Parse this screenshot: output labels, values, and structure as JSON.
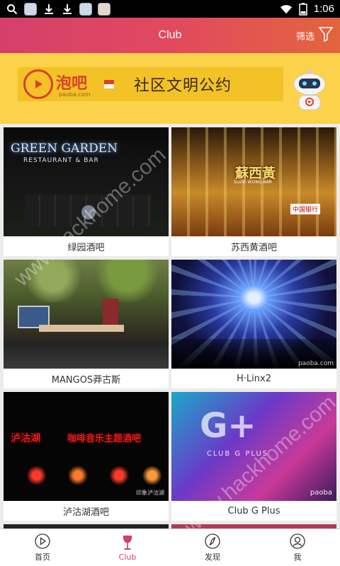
{
  "status_bar": {
    "time": "1:06",
    "battery": "8"
  },
  "header": {
    "title": "Club",
    "filter_label": "筛选"
  },
  "banner": {
    "logo_text": "泡吧",
    "logo_sub": "paoba.com",
    "slogan": "社区文明公约",
    "dots": [
      true,
      false,
      false,
      false
    ]
  },
  "venues": [
    {
      "name": "绿园酒吧",
      "sign": "GREEN GARDEN",
      "sign_sub": "RESTAURANT & BAR"
    },
    {
      "name": "苏西黄酒吧",
      "sign": "蘇西黃",
      "sign_sub": "SUZIE WONG BAR",
      "sign_side": "中国银行"
    },
    {
      "name": "MANGOS莽古斯",
      "sign": ""
    },
    {
      "name": "H·Linx2",
      "sign": "",
      "watermark": "paoba.com"
    },
    {
      "name": "泸沽湖酒吧",
      "sign": "泸沽湖",
      "sign_b": "咖啡音乐主题酒吧",
      "watermark": "印象泸沽湖"
    },
    {
      "name": "Club G Plus",
      "sign": "G+",
      "sign_b": "CLUB G PLUS",
      "watermark": "paoba"
    }
  ],
  "bottom_nav": [
    {
      "label": "首页",
      "icon": "home-icon",
      "active": false
    },
    {
      "label": "Club",
      "icon": "wine-glass-icon",
      "active": true
    },
    {
      "label": "发现",
      "icon": "compass-icon",
      "active": false
    },
    {
      "label": "我",
      "icon": "user-icon",
      "active": false
    }
  ],
  "watermark": "www.hackhome.com",
  "colors": {
    "accent": "#d63f6b",
    "header_end": "#e2653d",
    "banner": "#fbd24a",
    "dot_active": "#22b573"
  }
}
